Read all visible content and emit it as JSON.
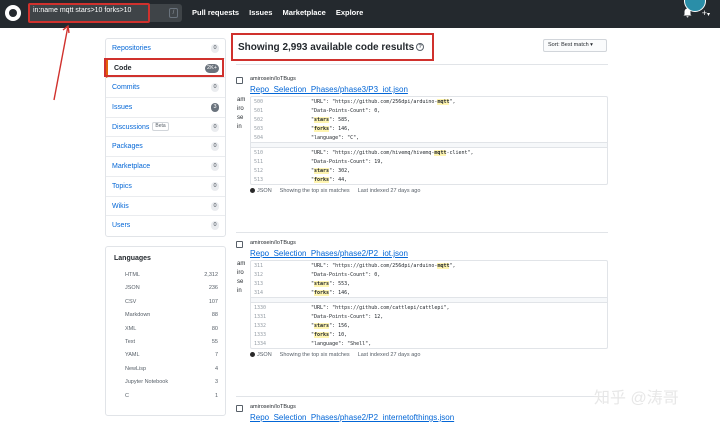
{
  "header": {
    "search_value": "in:name mqtt stars>10 forks>10",
    "search_slash": "/",
    "nav": [
      "Pull requests",
      "Issues",
      "Marketplace",
      "Explore"
    ],
    "bell_icon": "bell-icon",
    "plus_label": "+",
    "plus_caret": "▾"
  },
  "sidebar": {
    "items": [
      {
        "label": "Repositories",
        "count": "0"
      },
      {
        "label": "Code",
        "count": "2K+"
      },
      {
        "label": "Commits",
        "count": "0"
      },
      {
        "label": "Issues",
        "count": "3"
      },
      {
        "label": "Discussions",
        "beta": "Beta",
        "count": "0"
      },
      {
        "label": "Packages",
        "count": "0"
      },
      {
        "label": "Marketplace",
        "count": "0"
      },
      {
        "label": "Topics",
        "count": "0"
      },
      {
        "label": "Wikis",
        "count": "0"
      },
      {
        "label": "Users",
        "count": "0"
      }
    ]
  },
  "languages": {
    "title": "Languages",
    "items": [
      {
        "name": "HTML",
        "count": "2,312"
      },
      {
        "name": "JSON",
        "count": "236"
      },
      {
        "name": "CSV",
        "count": "107"
      },
      {
        "name": "Markdown",
        "count": "88"
      },
      {
        "name": "XML",
        "count": "80"
      },
      {
        "name": "Text",
        "count": "55"
      },
      {
        "name": "YAML",
        "count": "7"
      },
      {
        "name": "NewLisp",
        "count": "4"
      },
      {
        "name": "Jupyter Notebook",
        "count": "3"
      },
      {
        "name": "C",
        "count": "1"
      }
    ]
  },
  "main": {
    "title": "Showing 2,993 available code results",
    "help": "?",
    "sort_label": "Sort: Best match ▾"
  },
  "results": [
    {
      "repo": "amirosein/IoTBugs",
      "file": "Repo_Selection_Phases/phase3/P3_iot.json",
      "letters": [
        "am",
        "iro",
        "se",
        "in"
      ],
      "blocks": [
        [
          {
            "ln": "500",
            "pre": "\"URL\": \"https://github.com/256dpi/arduino-",
            "hl": "mqtt",
            "post": "\","
          },
          {
            "ln": "501",
            "pre": "\"Data-Points-Count\": 0,",
            "hl": "",
            "post": ""
          },
          {
            "ln": "502",
            "pre": "\"",
            "hl": "stars",
            "post": "\": 585,"
          },
          {
            "ln": "503",
            "pre": "\"",
            "hl": "forks",
            "post": "\": 146,"
          },
          {
            "ln": "504",
            "pre": "\"language\": \"C\",",
            "hl": "",
            "post": ""
          }
        ],
        [
          {
            "ln": "510",
            "pre": "\"URL\": \"https://github.com/hivemq/hivemq-",
            "hl": "mqtt",
            "post": "-client\","
          },
          {
            "ln": "511",
            "pre": "\"Data-Points-Count\": 19,",
            "hl": "",
            "post": ""
          },
          {
            "ln": "512",
            "pre": "\"",
            "hl": "stars",
            "post": "\": 302,"
          },
          {
            "ln": "513",
            "pre": "\"",
            "hl": "forks",
            "post": "\": 44,"
          }
        ]
      ],
      "lang": "JSON",
      "matches": "Showing the top six matches",
      "indexed": "Last indexed 27 days ago"
    },
    {
      "repo": "amirosein/IoTBugs",
      "file": "Repo_Selection_Phases/phase2/P2_iot.json",
      "letters": [
        "am",
        "iro",
        "se",
        "in"
      ],
      "blocks": [
        [
          {
            "ln": "311",
            "pre": "\"URL\": \"https://github.com/256dpi/arduino-",
            "hl": "mqtt",
            "post": "\","
          },
          {
            "ln": "312",
            "pre": "\"Data-Points-Count\": 0,",
            "hl": "",
            "post": ""
          },
          {
            "ln": "313",
            "pre": "\"",
            "hl": "stars",
            "post": "\": 553,"
          },
          {
            "ln": "314",
            "pre": "\"",
            "hl": "forks",
            "post": "\": 146,"
          }
        ],
        [
          {
            "ln": "1330",
            "pre": "\"URL\": \"https://github.com/cattlepi/cattlepi\",",
            "hl": "",
            "post": ""
          },
          {
            "ln": "1331",
            "pre": "\"Data-Points-Count\": 12,",
            "hl": "",
            "post": ""
          },
          {
            "ln": "1332",
            "pre": "\"",
            "hl": "stars",
            "post": "\": 156,"
          },
          {
            "ln": "1333",
            "pre": "\"",
            "hl": "forks",
            "post": "\": 10,"
          },
          {
            "ln": "1334",
            "pre": "\"language\": \"Shell\",",
            "hl": "",
            "post": ""
          }
        ]
      ],
      "lang": "JSON",
      "matches": "Showing the top six matches",
      "indexed": "Last indexed 27 days ago"
    },
    {
      "repo": "amirosein/IoTBugs",
      "file": "Repo_Selection_Phases/phase2/P2_internetofthings.json"
    }
  ],
  "watermark": "知乎 @涛哥"
}
